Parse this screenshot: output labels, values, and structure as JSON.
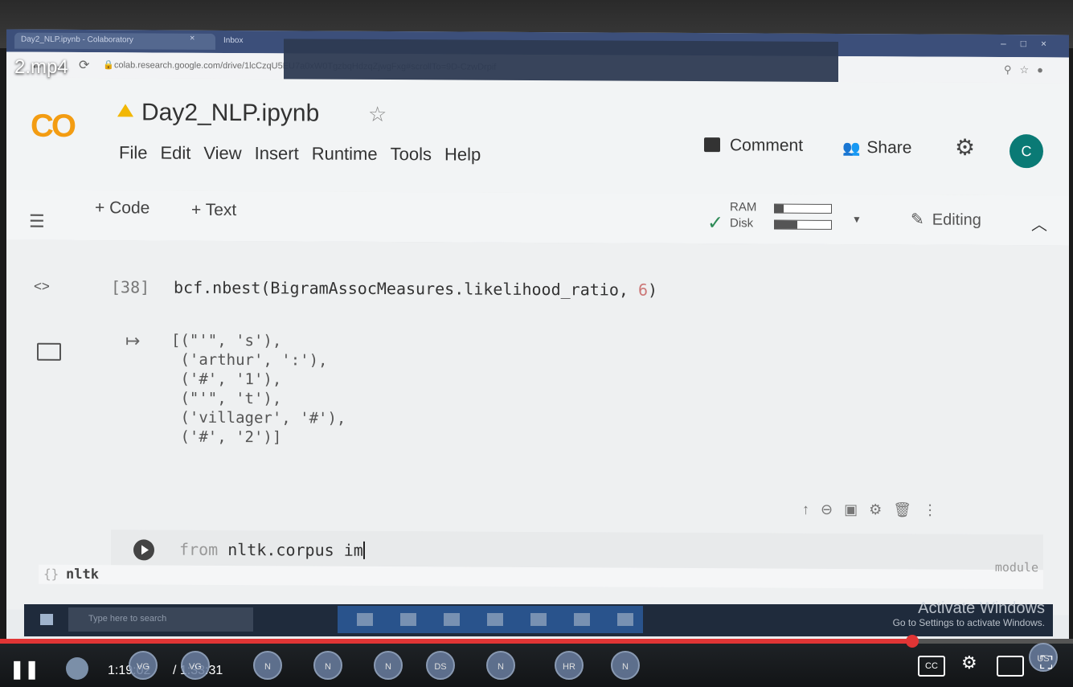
{
  "video": {
    "title": "2.mp4",
    "time_current": "1:19:02",
    "time_total": "/ 1:33:31",
    "progress": 0.85
  },
  "browser": {
    "tab_title": "Day2_NLP.ipynb - Colaboratory",
    "tab_close": "×",
    "tab2_title": "Inbox",
    "url": "colab.research.google.com/drive/1lcCzqU5EU7a0xW0TgzbqHdzqZjwgFxg#scrollTo=9D-CzwDrpif"
  },
  "colab": {
    "logo": "CO",
    "notebook_title": "Day2_NLP.ipynb",
    "menu": [
      "File",
      "Edit",
      "View",
      "Insert",
      "Runtime",
      "Tools",
      "Help"
    ],
    "comment_label": "Comment",
    "share_label": "Share",
    "avatar_letter": "C"
  },
  "toolbar": {
    "add_code": "+ Code",
    "add_text": "+ Text",
    "ram_label": "RAM",
    "disk_label": "Disk",
    "ram_usage": 0.15,
    "disk_usage": 0.4,
    "editing_label": "Editing"
  },
  "cell": {
    "exec_count": "[38]",
    "code_prefix": "bcf.nbest(BigramAssocMeasures.likelihood_ratio, ",
    "code_num": "6",
    "code_suffix": ")",
    "output": "[(\"'\", 's'),\n ('arthur', ':'),\n ('#', '1'),\n (\"'\", 't'),\n ('villager', '#'),\n ('#', '2')]"
  },
  "input_cell": {
    "keyword": "from",
    "code": " nltk.corpus im"
  },
  "autocomplete": {
    "icon": "{}",
    "item": "nltk",
    "type": "module"
  },
  "taskbar": {
    "search_placeholder": "Type here to search",
    "activate_title": "Activate Windows",
    "activate_sub": "Go to Settings to activate Windows."
  },
  "participants": [
    "VG",
    "VG",
    "N",
    "N",
    "N",
    "DS",
    "N",
    "HR",
    "N",
    "US"
  ],
  "player": {
    "cc_label": "CC"
  },
  "colors": {
    "progress_red": "#e03535",
    "colab_orange": "#f39c12",
    "avatar_teal": "#0a7a75"
  }
}
